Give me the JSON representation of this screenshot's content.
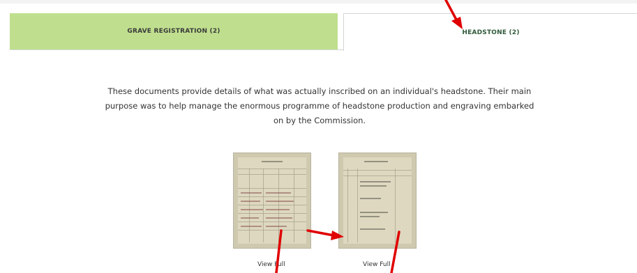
{
  "tabs": {
    "grave_registration": "GRAVE REGISTRATION (2)",
    "headstone": "HEADSTONE (2)"
  },
  "description": "These documents provide details of what was actually inscribed on an individual's headstone. Their main purpose was to help manage the enormous programme of headstone production and engraving embarked on by the Commission.",
  "documents": [
    {
      "view_label": "View Full"
    },
    {
      "view_label": "View Full"
    }
  ],
  "colors": {
    "active_tab_text": "#2f5a3a",
    "inactive_tab_bg": "#bfdf8e",
    "annotation_arrow": "#e00000"
  }
}
